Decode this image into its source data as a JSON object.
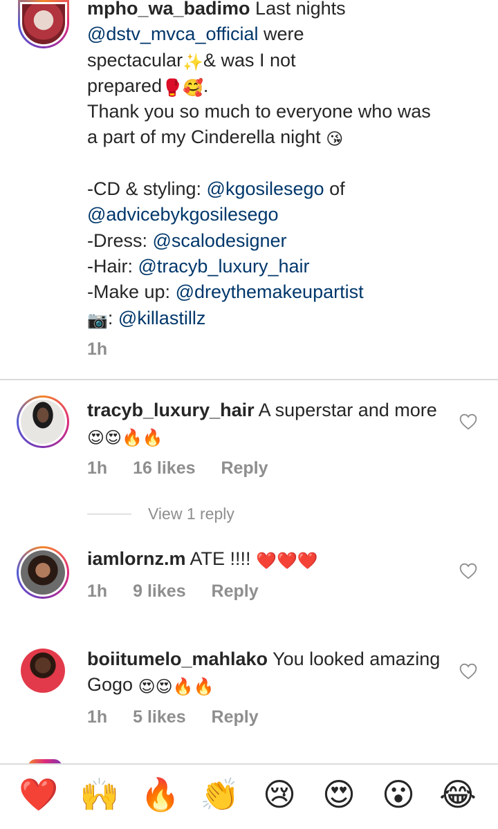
{
  "post": {
    "username": "mpho_wa_badimo",
    "caption": [
      [
        {
          "t": "Last nights"
        }
      ],
      [
        {
          "m": "@dstv_mvca_official"
        },
        {
          "t": " were"
        }
      ],
      [
        {
          "t": "spectacular"
        },
        {
          "e": "✨"
        },
        {
          "t": "& was I not"
        }
      ],
      [
        {
          "t": "prepared"
        },
        {
          "e": "🥊"
        },
        {
          "e": "🥰"
        },
        {
          "t": "."
        }
      ],
      [
        {
          "t": "Thank you so much to everyone who was"
        }
      ],
      [
        {
          "t": "a part of my Cinderella night "
        },
        {
          "e": "😘"
        }
      ],
      [],
      [
        {
          "t": "-CD & styling: "
        },
        {
          "m": "@kgosilesego"
        },
        {
          "t": " of"
        }
      ],
      [
        {
          "m": "@advicebykgosilesego"
        }
      ],
      [
        {
          "t": "-Dress: "
        },
        {
          "m": "@scalodesigner"
        }
      ],
      [
        {
          "t": "-Hair: "
        },
        {
          "m": "@tracyb_luxury_hair"
        }
      ],
      [
        {
          "t": "-Make up: "
        },
        {
          "m": "@dreythemakeupartist"
        }
      ],
      [
        {
          "e": "📷"
        },
        {
          "t": ": "
        },
        {
          "m": "@killastillz"
        }
      ]
    ],
    "time": "1h"
  },
  "comments": [
    {
      "username": "tracyb_luxury_hair",
      "text": "A superstar and more",
      "emojis": "😍😍🔥🔥",
      "time": "1h",
      "likes": "16 likes",
      "reply_label": "Reply",
      "view_replies": "View 1 reply"
    },
    {
      "username": "iamlornz.m",
      "text": "ATE !!!!",
      "emojis": "❤️❤️❤️",
      "time": "1h",
      "likes": "9 likes",
      "reply_label": "Reply"
    },
    {
      "username": "boiitumelo_mahlako",
      "text": "You looked amazing Gogo",
      "emojis": "😍😍🔥🔥",
      "time": "1h",
      "likes": "5 likes",
      "reply_label": "Reply"
    }
  ],
  "reactions": [
    {
      "name": "red-heart",
      "emoji": "❤️"
    },
    {
      "name": "raising-hands",
      "emoji": "🙌"
    },
    {
      "name": "fire",
      "emoji": "🔥"
    },
    {
      "name": "clapping-hands",
      "emoji": "👏"
    },
    {
      "name": "crying-face",
      "emoji": "😢"
    },
    {
      "name": "heart-eyes",
      "emoji": "😍"
    },
    {
      "name": "surprised-face",
      "emoji": "😮"
    },
    {
      "name": "tears-of-joy",
      "emoji": "😂"
    }
  ],
  "colors": {
    "mention": "#00376b",
    "meta": "#8e8e8e",
    "divider": "#dbdbdb"
  }
}
